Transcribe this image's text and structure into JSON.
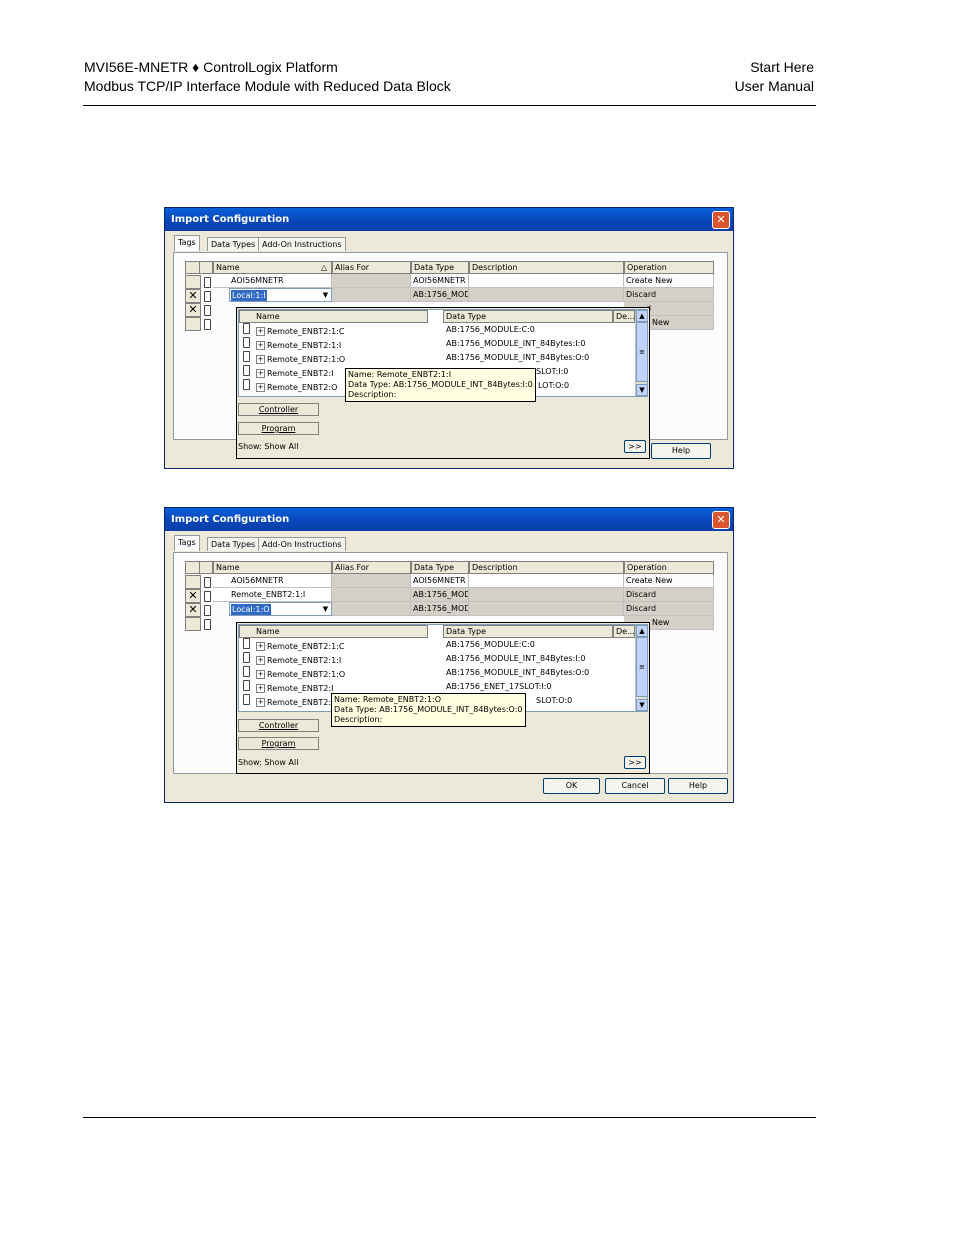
{
  "header": {
    "left_line1": "MVI56E-MNETR ♦ ControlLogix Platform",
    "left_line2": "Modbus TCP/IP Interface Module with Reduced Data Block",
    "right_line1": "Start Here",
    "right_line2": "User Manual"
  },
  "dialogs": [
    {
      "title": "Import Configuration",
      "tabs": [
        "Tags",
        "Data Types",
        "Add-On Instructions"
      ],
      "columns": [
        "Name",
        "Alias For",
        "Data Type",
        "Description",
        "Operation"
      ],
      "rows": [
        {
          "name": "AOI56MNETR",
          "datatype": "AOI56MNETR",
          "operation": "Create New"
        },
        {
          "name": "Local:1:I",
          "datatype": "AB:1756_MOD",
          "operation": "Discard"
        },
        {
          "name": "",
          "datatype": "",
          "operation": "d"
        },
        {
          "name": "",
          "datatype": "",
          "operation": "New"
        }
      ],
      "popup_columns": [
        "Name",
        "Data Type",
        "De..."
      ],
      "popup_items": [
        {
          "name": "Remote_ENBT2:1:C",
          "type": "AB:1756_MODULE:C:0"
        },
        {
          "name": "Remote_ENBT2:1:I",
          "type": "AB:1756_MODULE_INT_84Bytes:I:0"
        },
        {
          "name": "Remote_ENBT2:1:O",
          "type": "AB:1756_MODULE_INT_84Bytes:O:0"
        },
        {
          "name": "Remote_ENBT2:I",
          "type": "SLOT:I:0"
        },
        {
          "name": "Remote_ENBT2:O",
          "type": "LOT:O:0"
        }
      ],
      "tooltip": [
        "Name: Remote_ENBT2:1:I",
        "Data Type: AB:1756_MODULE_INT_84Bytes:I:0",
        "Description:"
      ],
      "popup_buttons": [
        "Controller",
        "Program"
      ],
      "show_label": "Show: Show All",
      "more_button": ">>",
      "buttons": [
        "Help"
      ]
    },
    {
      "title": "Import Configuration",
      "tabs": [
        "Tags",
        "Data Types",
        "Add-On Instructions"
      ],
      "columns": [
        "Name",
        "Alias For",
        "Data Type",
        "Description",
        "Operation"
      ],
      "rows": [
        {
          "name": "AOI56MNETR",
          "datatype": "AOI56MNETR",
          "operation": "Create New"
        },
        {
          "name": "Remote_ENBT2:1:I",
          "datatype": "AB:1756_MOD",
          "operation": "Discard"
        },
        {
          "name": "Local:1:O",
          "datatype": "AB:1756_MOD",
          "operation": "Discard"
        },
        {
          "name": "",
          "datatype": "",
          "operation": "New"
        }
      ],
      "popup_columns": [
        "Name",
        "Data Type",
        "De..."
      ],
      "popup_items": [
        {
          "name": "Remote_ENBT2:1:C",
          "type": "AB:1756_MODULE:C:0"
        },
        {
          "name": "Remote_ENBT2:1:I",
          "type": "AB:1756_MODULE_INT_84Bytes:I:0"
        },
        {
          "name": "Remote_ENBT2:1:O",
          "type": "AB:1756_MODULE_INT_84Bytes:O:0"
        },
        {
          "name": "Remote_ENBT2:I",
          "type": "AB:1756_ENET_17SLOT:I:0"
        },
        {
          "name": "Remote_ENBT2:O",
          "type": "SLOT:O:0"
        }
      ],
      "tooltip": [
        "Name: Remote_ENBT2:1:O",
        "Data Type: AB:1756_MODULE_INT_84Bytes:O:0",
        "Description:"
      ],
      "popup_buttons": [
        "Controller",
        "Program"
      ],
      "show_label": "Show: Show All",
      "more_button": ">>",
      "buttons": [
        "OK",
        "Cancel",
        "Help"
      ]
    }
  ]
}
